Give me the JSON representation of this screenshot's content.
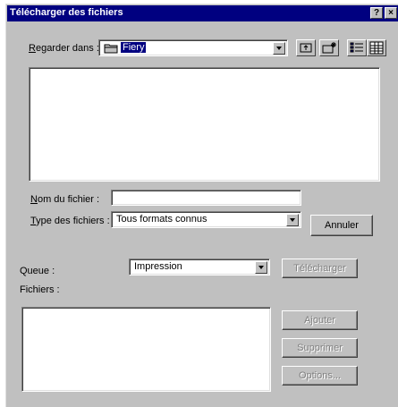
{
  "window": {
    "title": "Télécharger des fichiers",
    "help_glyph": "?",
    "close_glyph": "×"
  },
  "look_in": {
    "label_first": "R",
    "label_rest": "egarder dans :",
    "value": "Fiery"
  },
  "file_name": {
    "label_first": "N",
    "label_rest": "om du fichier :",
    "value": ""
  },
  "file_type": {
    "label_first": "T",
    "label_rest": "ype des fichiers :",
    "value": "Tous formats connus"
  },
  "buttons": {
    "cancel": "Annuler",
    "download": "Télécharger",
    "add": "Ajouter",
    "remove": "Supprimer",
    "options": "Options..."
  },
  "queue": {
    "label": "Queue :",
    "value": "Impression"
  },
  "files_label": "Fichiers :"
}
